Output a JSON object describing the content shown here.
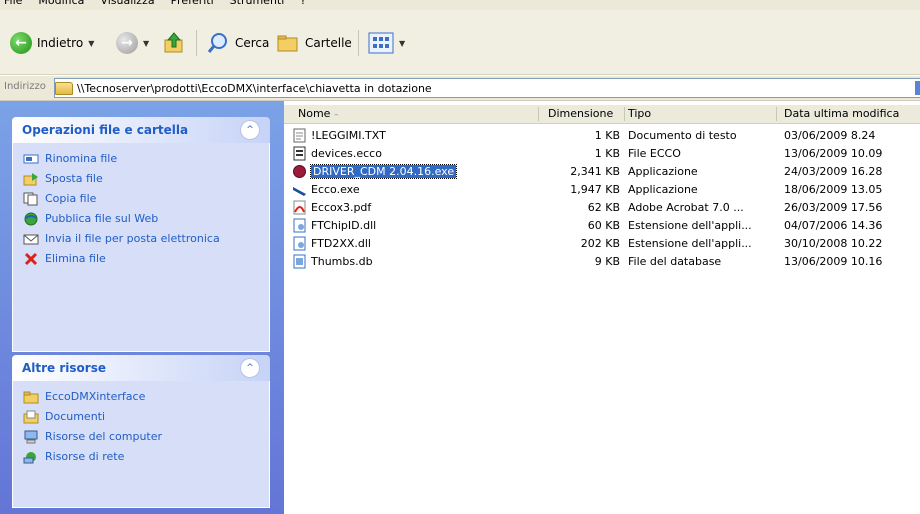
{
  "menu": [
    "File",
    "Modifica",
    "Visualizza",
    "Preferiti",
    "Strumenti",
    "?"
  ],
  "toolbar": {
    "back_label": "Indietro",
    "search_label": "Cerca",
    "folders_label": "Cartelle"
  },
  "address": {
    "label": "Indirizzo",
    "path": "\\\\Tecnoserver\\prodotti\\EccoDMX\\interface\\chiavetta in dotazione"
  },
  "task_pane": {
    "file_tasks": {
      "title": "Operazioni file e cartella",
      "items": [
        {
          "label": "Rinomina file",
          "icon": "rename-icon"
        },
        {
          "label": "Sposta file",
          "icon": "move-icon"
        },
        {
          "label": "Copia file",
          "icon": "copy-icon"
        },
        {
          "label": "Pubblica file sul Web",
          "icon": "globe-icon"
        },
        {
          "label": "Invia il file per posta elettronica",
          "icon": "mail-icon"
        },
        {
          "label": "Elimina file",
          "icon": "delete-icon"
        }
      ]
    },
    "other_places": {
      "title": "Altre risorse",
      "items": [
        {
          "label": "EccoDMXinterface",
          "icon": "folder-icon"
        },
        {
          "label": "Documenti",
          "icon": "documents-icon"
        },
        {
          "label": "Risorse del computer",
          "icon": "computer-icon"
        },
        {
          "label": "Risorse di rete",
          "icon": "network-icon"
        }
      ]
    }
  },
  "columns": {
    "name": "Nome",
    "size": "Dimensione",
    "type": "Tipo",
    "date": "Data ultima modifica"
  },
  "files": [
    {
      "name": "!LEGGIMI.TXT",
      "size": "1 KB",
      "type": "Documento di testo",
      "date": "03/06/2009 8.24",
      "icon": "text-file-icon",
      "selected": false
    },
    {
      "name": "devices.ecco",
      "size": "1 KB",
      "type": "File ECCO",
      "date": "13/06/2009 10.09",
      "icon": "generic-file-icon",
      "selected": false
    },
    {
      "name": "DRIVER_CDM 2.04.16.exe",
      "size": "2,341 KB",
      "type": "Applicazione",
      "date": "24/03/2009 16.28",
      "icon": "installer-icon",
      "selected": true
    },
    {
      "name": "Ecco.exe",
      "size": "1,947 KB",
      "type": "Applicazione",
      "date": "18/06/2009 13.05",
      "icon": "app-icon",
      "selected": false
    },
    {
      "name": "Eccox3.pdf",
      "size": "62 KB",
      "type": "Adobe Acrobat 7.0 ...",
      "date": "26/03/2009 17.56",
      "icon": "pdf-icon",
      "selected": false
    },
    {
      "name": "FTChipID.dll",
      "size": "60 KB",
      "type": "Estensione dell'appli...",
      "date": "04/07/2006 14.36",
      "icon": "dll-icon",
      "selected": false
    },
    {
      "name": "FTD2XX.dll",
      "size": "202 KB",
      "type": "Estensione dell'appli...",
      "date": "30/10/2008 10.22",
      "icon": "dll-icon",
      "selected": false
    },
    {
      "name": "Thumbs.db",
      "size": "9 KB",
      "type": "File del database",
      "date": "13/06/2009 10.16",
      "icon": "db-icon",
      "selected": false
    }
  ],
  "colors": {
    "selection": "#316ac5",
    "taskpane_link": "#215dc6",
    "taskpane_bg": "#7ba2e7"
  }
}
